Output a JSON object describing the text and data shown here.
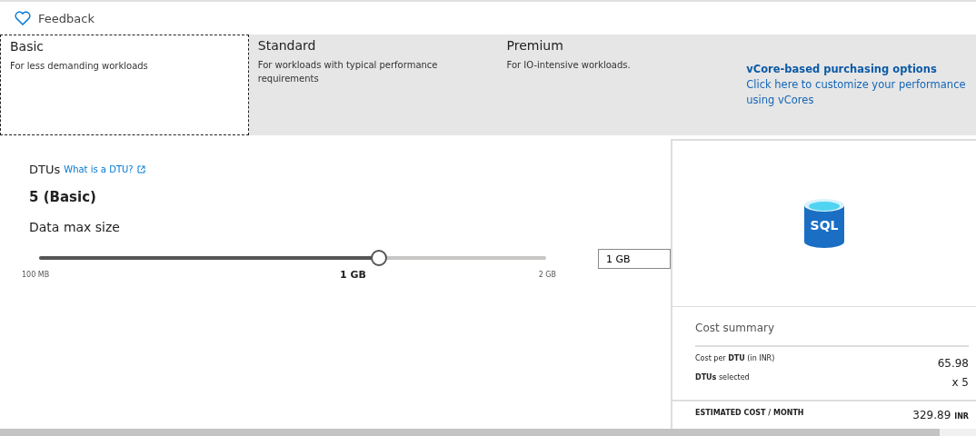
{
  "feedback": {
    "label": "Feedback"
  },
  "tiers": [
    {
      "name": "Basic",
      "description": "For less demanding workloads",
      "selected": true
    },
    {
      "name": "Standard",
      "description": "For workloads with typical performance requirements",
      "selected": false
    },
    {
      "name": "Premium",
      "description": "For IO-intensive workloads.",
      "selected": false
    }
  ],
  "vcore": {
    "title": "vCore-based purchasing options",
    "text": "Click here to customize your performance using vCores"
  },
  "dtus": {
    "label": "DTUs",
    "link": "What is a DTU?",
    "value": "5 (Basic)"
  },
  "size": {
    "label": "Data max size",
    "min": "100 MB",
    "max": "2 GB",
    "current": "1 GB",
    "level": 0.668,
    "input": "1 GB"
  },
  "summary": {
    "icon_text": "SQL",
    "title": "Cost summary",
    "rows": [
      {
        "label": "Cost per **DTU** (in INR)",
        "value": "65.98"
      },
      {
        "label": "**DTUs** selected",
        "value": "x 5"
      }
    ],
    "total": {
      "label": "ESTIMATED COST / MONTH",
      "value": "329.89",
      "unit": "INR"
    }
  }
}
